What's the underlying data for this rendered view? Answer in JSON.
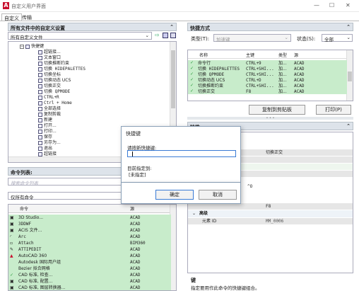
{
  "window": {
    "title": "自定义用户界面",
    "close": "✕",
    "min": "—",
    "max": "☐",
    "icon_color": "#c8102e"
  },
  "tabs": [
    {
      "label": "自定义"
    },
    {
      "label": "传输"
    }
  ],
  "left": {
    "files_header": "所有文件中的自定义设置",
    "files_combo": "所有自定义文件",
    "tree": [
      {
        "label": "快捷键",
        "indent": 2
      },
      {
        "label": "超链接...",
        "indent": 3
      },
      {
        "label": "文本窗口",
        "indent": 3
      },
      {
        "label": "切换推断约束",
        "indent": 3
      },
      {
        "label": "切换 HIDEPALETTES",
        "indent": 3
      },
      {
        "label": "切换坐标",
        "indent": 3
      },
      {
        "label": "切换动态 UCS",
        "indent": 3
      },
      {
        "label": "切换正交",
        "indent": 3
      },
      {
        "label": "切换 QPMODE",
        "indent": 3
      },
      {
        "label": "CTRL+R",
        "indent": 3
      },
      {
        "label": "Ctrl + Home",
        "indent": 3
      },
      {
        "label": "全部选择",
        "indent": 3
      },
      {
        "label": "复制剪裁",
        "indent": 3
      },
      {
        "label": "新建",
        "indent": 3
      },
      {
        "label": "打开...",
        "indent": 3
      },
      {
        "label": "打印...",
        "indent": 3
      },
      {
        "label": "保存",
        "indent": 3
      },
      {
        "label": "另存为...",
        "indent": 3
      },
      {
        "label": "退出",
        "indent": 3
      },
      {
        "label": "超链接",
        "indent": 3
      }
    ],
    "cmd_header": "命令列表:",
    "search_placeholder": "搜索命令列表",
    "cmd_filter": "仅所有命令",
    "cmd_cols": {
      "name": "命令",
      "source": "源"
    },
    "commands": [
      {
        "name": "3D Studio...",
        "source": "ACAD"
      },
      {
        "name": "3DDWF",
        "source": "ACAD"
      },
      {
        "name": "ACIS 文件...",
        "source": "ACAD"
      },
      {
        "name": "Arc",
        "source": "ACAD"
      },
      {
        "name": "Attach",
        "source": "BIM360"
      },
      {
        "name": "ATTIPEDIT",
        "source": "ACAD"
      },
      {
        "name": "AutoCAD 360",
        "source": "ACAD"
      },
      {
        "name": "Autodesk 国际用户组",
        "source": "ACAD"
      },
      {
        "name": "Bezier 拟合网格",
        "source": "ACAD"
      },
      {
        "name": "CAD 标准, 检查...",
        "source": "ACAD"
      },
      {
        "name": "CAD 标准, 配置...",
        "source": "ACAD"
      },
      {
        "name": "CAD 标准, 图层转换器...",
        "source": "ACAD"
      }
    ]
  },
  "right": {
    "shortcuts_header": "快捷方式",
    "type_label": "类型(T):",
    "type_value": "加速键",
    "status_label": "状态(S):",
    "status_value": "全部",
    "cols": {
      "name": "名称",
      "key": "主键",
      "type": "类型",
      "source": "源"
    },
    "rows": [
      {
        "name": "命令行",
        "key": "CTRL+9",
        "type": "加...",
        "source": "ACAD"
      },
      {
        "name": "切换 HIDEPALETTES",
        "key": "CTRL+SHI...",
        "type": "加...",
        "source": "ACAD"
      },
      {
        "name": "切换 QPMODE",
        "key": "CTRL+SHI...",
        "type": "加...",
        "source": "ACAD"
      },
      {
        "name": "切换动态 UCS",
        "key": "CTRL+D",
        "type": "加...",
        "source": "ACAD"
      },
      {
        "name": "切换推断约束",
        "key": "CTRL+SHI...",
        "type": "加...",
        "source": "ACAD"
      },
      {
        "name": "切换正交",
        "key": "F8",
        "type": "加...",
        "source": "ACAD"
      }
    ],
    "copy_button": "复制到剪贴板",
    "print_button": "打印(P)",
    "props_header": "特性",
    "prop_value_name": "切换正交",
    "prop_macro": "^O",
    "prop_key": "F8",
    "advanced_label": "高级",
    "element_id_label": "元素 ID",
    "element_id_value": "MM_0006",
    "desc_title": "键",
    "desc_text": "指定要用作此命令的快捷键组合。"
  },
  "dialog": {
    "title": "快捷键",
    "prompt": "请按新快捷键:",
    "assigned_label": "目前指定到:",
    "assigned_value": "[未指定]",
    "ok": "确定",
    "cancel": "取消"
  }
}
